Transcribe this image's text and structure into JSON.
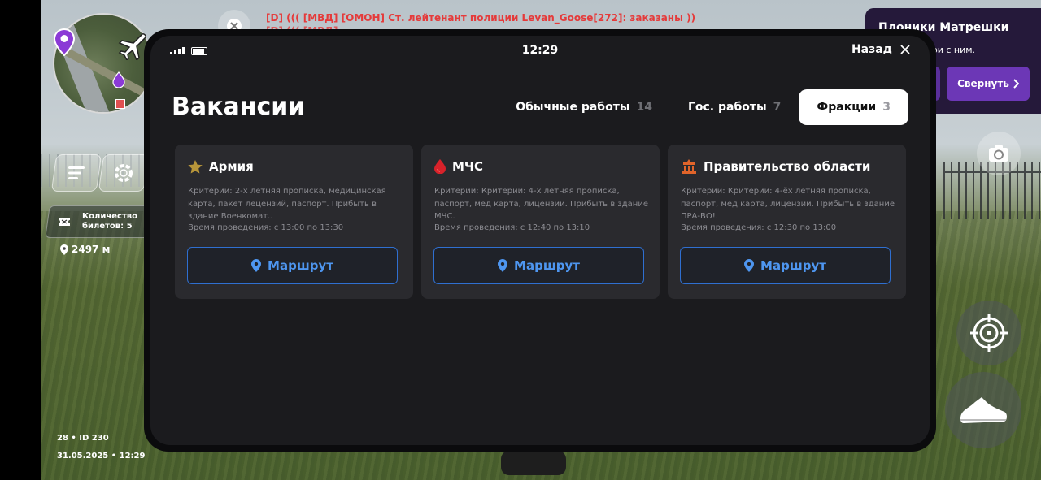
{
  "hud": {
    "chat_line_1": "[D] ((( [МВД] [ОМОН] Ст. лейтенант полиции Levan_Goose[272]: заказаны ))",
    "chat_line_2": "[D] ((( [МВД] ....................................................................................................",
    "tickets_label": "Количество\nбилетов: 5",
    "distance": "2497 м",
    "id_line": "28 • ID 230",
    "date_line": "31.05.2025 • 12:29"
  },
  "quest": {
    "title": "Плоники Матрешки",
    "text": "на и поговори с ним.",
    "collapse_label": "Свернуть"
  },
  "phone": {
    "time": "12:29",
    "back_label": "Назад",
    "title": "Вакансии",
    "tabs": [
      {
        "label": "Обычные работы",
        "count": "14",
        "active": false
      },
      {
        "label": "Гос. работы",
        "count": "7",
        "active": false
      },
      {
        "label": "Фракции",
        "count": "3",
        "active": true
      }
    ],
    "cards": [
      {
        "icon": "star-icon",
        "icon_color": "#b8963a",
        "name": "Армия",
        "criteria": "Критерии: 2-х летняя прописка, медицинская карта, пакет лецензий, паспорт. Прибыть в здание Военкомат..",
        "time": "Время проведения: с 13:00 по 13:30",
        "route_label": "Маршрут"
      },
      {
        "icon": "drop-icon",
        "icon_color": "#d8222a",
        "name": "МЧС",
        "criteria": "Критерии: Критерии: 4-х летняя прописка, паспорт, мед карта, лицензии. Прибыть в здание МЧС.",
        "time": "Время проведения: с 12:40 по 13:10",
        "route_label": "Маршрут"
      },
      {
        "icon": "government-building-icon",
        "icon_color": "#e0642a",
        "name": "Правительство области",
        "criteria": "Критерии: Критерии: 4-ёх летняя прописка, паспорт, мед карта, лицензии. Прибыть в здание ПРА-ВО!.",
        "time": "Время проведения: с 12:30 по 13:00",
        "route_label": "Маршрут"
      }
    ]
  },
  "colors": {
    "accent_blue": "#4e96f0",
    "route_border": "#2f6fd0",
    "chat_red": "#e53a3a",
    "quest_purple": "#6c37b6"
  }
}
